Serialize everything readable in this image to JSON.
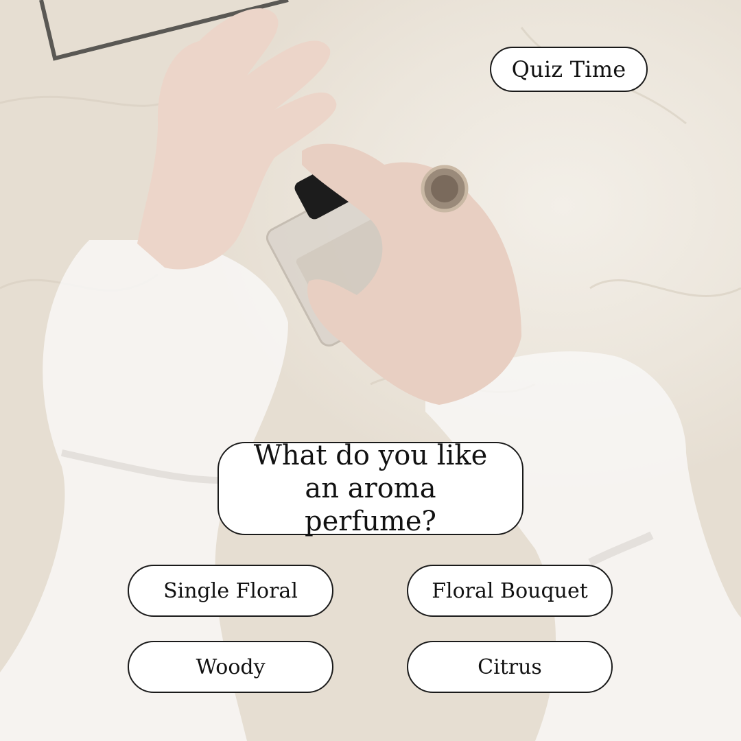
{
  "badge": {
    "label": "Quiz Time"
  },
  "question": {
    "text": "What do you like an aroma perfume?"
  },
  "options": [
    {
      "label": "Single Floral"
    },
    {
      "label": "Floral Bouquet"
    },
    {
      "label": "Woody"
    },
    {
      "label": "Citrus"
    }
  ],
  "colors": {
    "pill_background": "#ffffff",
    "pill_border": "#1a1a1a",
    "text": "#111111",
    "backdrop": "#ebe4d9"
  },
  "icons": [
    "perfume-bottle-photo"
  ]
}
